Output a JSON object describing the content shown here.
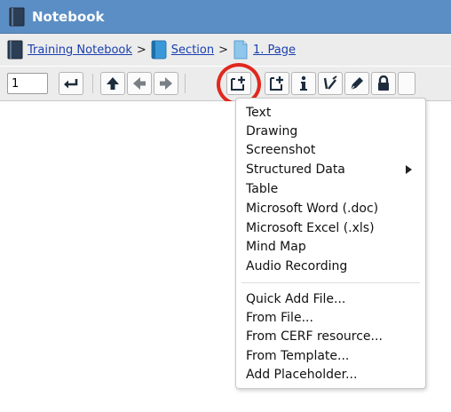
{
  "window": {
    "title": "Notebook"
  },
  "breadcrumb": {
    "notebook": "Training Notebook",
    "section": "Section",
    "page": "1. Page",
    "separator": ">"
  },
  "toolbar": {
    "page_number": "1",
    "buttons": [
      {
        "name": "enter",
        "icon": "return-arrow-icon"
      },
      {
        "name": "up",
        "icon": "arrow-up-icon"
      },
      {
        "name": "back",
        "icon": "arrow-left-icon"
      },
      {
        "name": "forward",
        "icon": "arrow-right-icon"
      },
      {
        "name": "add-entry",
        "icon": "add-entry-icon"
      },
      {
        "name": "new-page",
        "icon": "add-page-icon"
      },
      {
        "name": "info",
        "icon": "info-icon"
      },
      {
        "name": "sign",
        "icon": "sign-icon"
      },
      {
        "name": "pen",
        "icon": "pen-icon"
      },
      {
        "name": "lock",
        "icon": "lock-icon"
      }
    ]
  },
  "add_menu": {
    "group1": [
      "Text",
      "Drawing",
      "Screenshot",
      "Structured Data",
      "Table",
      "Microsoft Word (.doc)",
      "Microsoft Excel (.xls)",
      "Mind Map",
      "Audio Recording"
    ],
    "group2": [
      "Quick Add File...",
      "From File...",
      "From CERF resource...",
      "From Template...",
      "Add Placeholder..."
    ]
  },
  "colors": {
    "title_bar": "#5b8ec4",
    "link": "#1a3fb0",
    "highlight_ring": "#e0281e"
  }
}
